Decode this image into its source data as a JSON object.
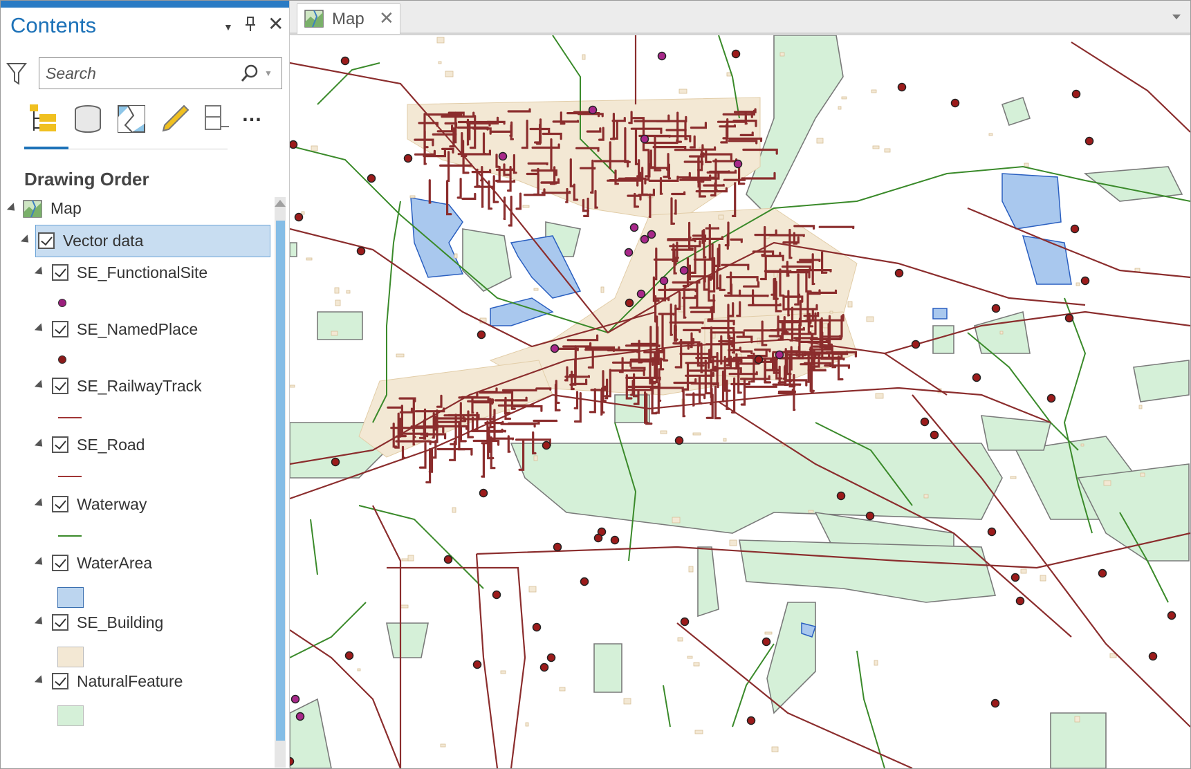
{
  "contents_pane": {
    "title": "Contents",
    "search": {
      "placeholder": "Search"
    },
    "section_heading": "Drawing Order",
    "map_item": {
      "label": "Map"
    },
    "group_item": {
      "label": "Vector data"
    },
    "layers": [
      {
        "label": "SE_FunctionalSite",
        "symbol": "point",
        "color": "#9b1f7d"
      },
      {
        "label": "SE_NamedPlace",
        "symbol": "point",
        "color": "#8b1a1a"
      },
      {
        "label": "SE_RailwayTrack",
        "symbol": "line",
        "color": "#a03535"
      },
      {
        "label": "SE_Road",
        "symbol": "line",
        "color": "#a03535"
      },
      {
        "label": "Waterway",
        "symbol": "line",
        "color": "#3a8a2a"
      },
      {
        "label": "WaterArea",
        "symbol": "fill",
        "color": "#bcd5ef"
      },
      {
        "label": "SE_Building",
        "symbol": "fill",
        "color": "#f3e8d4"
      },
      {
        "label": "NaturalFeature",
        "symbol": "fill",
        "color": "#d5f0d8"
      }
    ]
  },
  "map_view": {
    "tab_label": "Map"
  },
  "colors": {
    "accent": "#1d72b8",
    "road": "#8b2d2d",
    "building": "#f3e8d4",
    "water": "#a9c8ee",
    "natural": "#d5f0d8",
    "waterway": "#3a8a2a"
  }
}
